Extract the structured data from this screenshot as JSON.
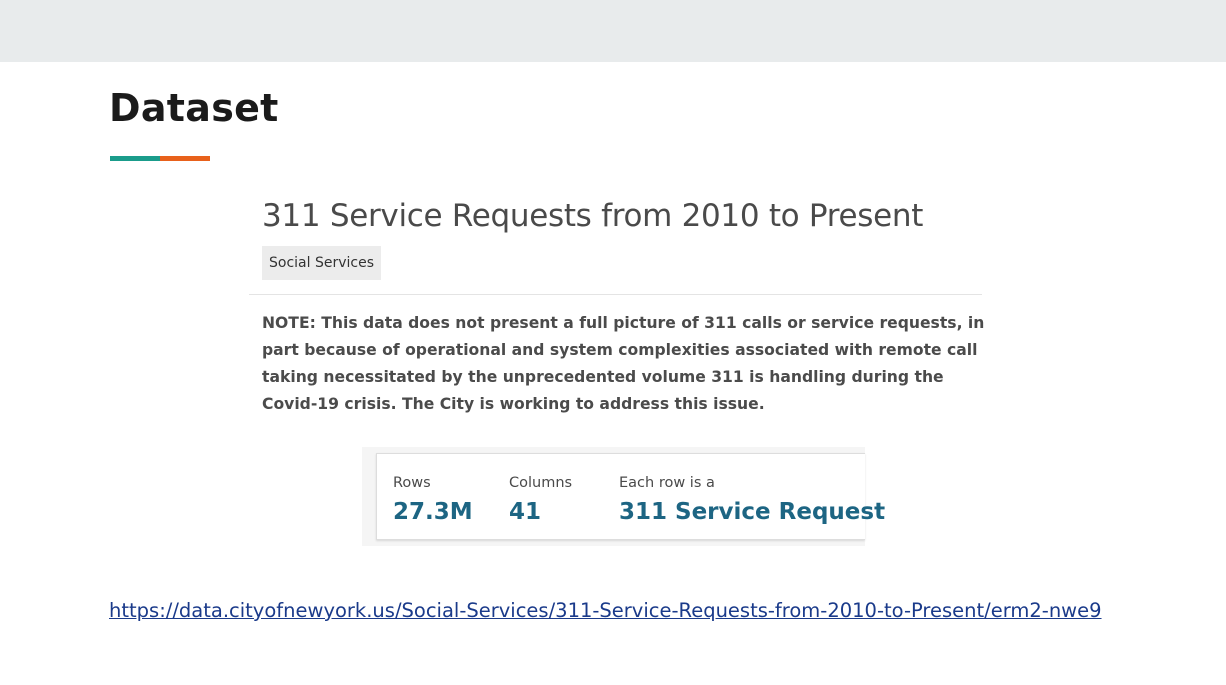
{
  "slide": {
    "title": "Dataset",
    "accent_colors": [
      "#1a9c8b",
      "#e8611b"
    ]
  },
  "dataset": {
    "title": "311 Service Requests from 2010 to Present",
    "category": "Social Services",
    "note": "NOTE: This data does not present a full picture of 311 calls or service requests, in part because of operational and system complexities associated with remote call taking necessitated by the unprecedented volume 311 is handling during the Covid-19 crisis. The City is working to address this issue.",
    "stats": {
      "rows_label": "Rows",
      "rows_value": "27.3M",
      "columns_label": "Columns",
      "columns_value": "41",
      "each_row_label": "Each row is a",
      "each_row_value": "311 Service Request"
    }
  },
  "link": {
    "url": "https://data.cityofnewyork.us/Social-Services/311-Service-Requests-from-2010-to-Present/erm2-nwe9"
  }
}
